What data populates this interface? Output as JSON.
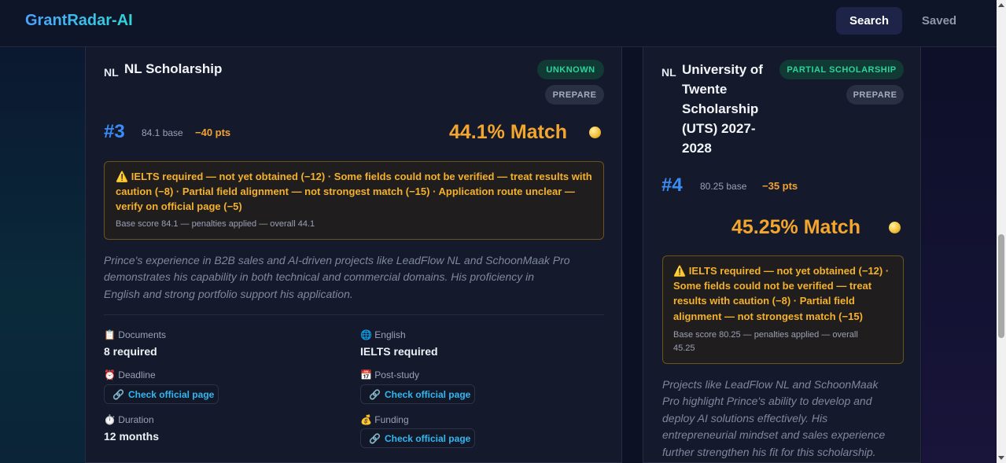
{
  "header": {
    "brand": "GrantRadar-AI",
    "nav": {
      "search": "Search",
      "saved": "Saved"
    }
  },
  "cards": [
    {
      "flag": "NL",
      "title": "NL Scholarship",
      "status": "UNKNOWN",
      "action": "PREPARE",
      "rank": "#3",
      "base": "84.1 base",
      "penalty": "−40 pts",
      "match": "44.1% Match",
      "warning_lines": [
        "⚠️ IELTS required — not yet obtained (−12) · Some fields could not be verified — treat results with",
        "caution (−8) · Partial field alignment — not strongest match (−15) · Application route unclear —",
        "verify on official page (−5)"
      ],
      "warning_sub": "Base score 84.1 — penalties applied — overall 44.1",
      "summary_lines": [
        "Prince's experience in B2B sales and AI-driven projects like LeadFlow NL and SchoonMaak Pro",
        "demonstrates his capability in both technical and commercial domains. His proficiency in",
        "English and strong portfolio support his application."
      ],
      "meta": {
        "documents_label": "📋 Documents",
        "documents_value": "8 required",
        "english_label": "🌐 English",
        "english_value": "IELTS required",
        "deadline_label": "⏰ Deadline",
        "deadline_link": "Check official page",
        "poststudy_label": "📅 Post-study",
        "poststudy_link": "Check official page",
        "duration_label": "⏱️ Duration",
        "duration_value": "12 months",
        "funding_label": "💰 Funding",
        "funding_link": "Check official page"
      }
    },
    {
      "flag": "NL",
      "title_lines": [
        "University of",
        "Twente",
        "Scholarship",
        "(UTS) 2027-",
        "2028"
      ],
      "status": "PARTIAL SCHOLARSHIP",
      "action": "PREPARE",
      "rank": "#4",
      "base": "80.25 base",
      "penalty": "−35 pts",
      "match": "45.25% Match",
      "warning_lines": [
        "⚠️ IELTS required — not yet obtained (−12) ·",
        "Some fields could not be verified — treat",
        "results with caution (−8) · Partial field",
        "alignment — not strongest match (−15)"
      ],
      "warning_sub_lines": [
        "Base score 80.25 — penalties applied — overall",
        "45.25"
      ],
      "summary_lines": [
        "Projects like LeadFlow NL and SchoonMaak",
        "Pro highlight Prince's ability to develop and",
        "deploy AI solutions effectively. His",
        "entrepreneurial mindset and sales experience",
        "further strengthen his fit for this scholarship."
      ]
    }
  ],
  "colors": {
    "background": "#0c1124",
    "card": "#141a2c",
    "accent_blue": "#3a8df6",
    "match_orange": "#f4a52c",
    "status_green": "#2ed39a",
    "link_cyan": "#33b7f0"
  },
  "icons": {
    "link": "link-icon",
    "coin": "coin-icon"
  }
}
